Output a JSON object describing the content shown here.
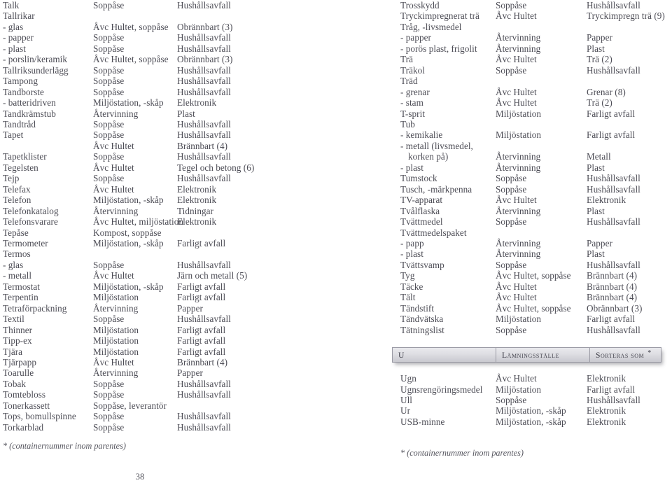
{
  "document": {
    "page_number": "38",
    "footnote": "* (containernummer inom parentes)"
  },
  "section_header": {
    "letter": "U",
    "place_column": "Lämningsställe",
    "sort_column": "Sorteras som",
    "asterisk": "*"
  },
  "left_column": {
    "rows": [
      {
        "item": "Talk",
        "indent": false,
        "place": "Soppåse",
        "sort": "Hushållsavfall"
      },
      {
        "item": "Tallrikar",
        "indent": false,
        "place": "",
        "sort": ""
      },
      {
        "item": "- glas",
        "indent": false,
        "place": "Åvc Hultet, soppåse",
        "sort": "Obrännbart (3)"
      },
      {
        "item": "- papper",
        "indent": false,
        "place": "Soppåse",
        "sort": "Hushållsavfall"
      },
      {
        "item": "- plast",
        "indent": false,
        "place": "Soppåse",
        "sort": "Hushållsavfall"
      },
      {
        "item": "- porslin/keramik",
        "indent": false,
        "place": "Åvc Hultet, soppåse",
        "sort": "Obrännbart (3)"
      },
      {
        "item": "Tallriksunderlägg",
        "indent": false,
        "place": "Soppåse",
        "sort": "Hushållsavfall"
      },
      {
        "item": "Tampong",
        "indent": false,
        "place": "Soppåse",
        "sort": "Hushållsavfall"
      },
      {
        "item": "Tandborste",
        "indent": false,
        "place": "Soppåse",
        "sort": "Hushållsavfall"
      },
      {
        "item": "- batteridriven",
        "indent": false,
        "place": "Miljöstation, -skåp",
        "sort": "Elektronik"
      },
      {
        "item": "Tandkrämstub",
        "indent": false,
        "place": "Återvinning",
        "sort": "Plast"
      },
      {
        "item": "Tandtråd",
        "indent": false,
        "place": "Soppåse",
        "sort": "Hushållsavfall"
      },
      {
        "item": "Tapet",
        "indent": false,
        "place": "Soppåse",
        "sort": "Hushållsavfall"
      },
      {
        "item": "",
        "indent": false,
        "place": "Åvc Hultet",
        "sort": "Brännbart (4)"
      },
      {
        "item": "Tapetklister",
        "indent": false,
        "place": "Soppåse",
        "sort": "Hushållsavfall"
      },
      {
        "item": "Tegelsten",
        "indent": false,
        "place": "Åvc Hultet",
        "sort": "Tegel och betong (6)"
      },
      {
        "item": "Tejp",
        "indent": false,
        "place": "Soppåse",
        "sort": "Hushållsavfall"
      },
      {
        "item": "Telefax",
        "indent": false,
        "place": "Åvc Hultet",
        "sort": "Elektronik"
      },
      {
        "item": "Telefon",
        "indent": false,
        "place": "Miljöstation, -skåp",
        "sort": "Elektronik"
      },
      {
        "item": "Telefonkatalog",
        "indent": false,
        "place": "Återvinning",
        "sort": "Tidningar"
      },
      {
        "item": "Telefonsvarare",
        "indent": false,
        "place": "Åvc Hultet, miljöstation",
        "sort": "Elektronik"
      },
      {
        "item": "Tepåse",
        "indent": false,
        "place": "Kompost, soppåse",
        "sort": ""
      },
      {
        "item": "Termometer",
        "indent": false,
        "place": "Miljöstation, -skåp",
        "sort": "Farligt avfall"
      },
      {
        "item": "Termos",
        "indent": false,
        "place": "",
        "sort": ""
      },
      {
        "item": "- glas",
        "indent": false,
        "place": "Soppåse",
        "sort": "Hushållsavfall"
      },
      {
        "item": "- metall",
        "indent": false,
        "place": "Åvc Hultet",
        "sort": "Järn och metall (5)"
      },
      {
        "item": "Termostat",
        "indent": false,
        "place": "Miljöstation, -skåp",
        "sort": "Farligt avfall"
      },
      {
        "item": "Terpentin",
        "indent": false,
        "place": "Miljöstation",
        "sort": "Farligt avfall"
      },
      {
        "item": "Tetraförpackning",
        "indent": false,
        "place": "Återvinning",
        "sort": "Papper"
      },
      {
        "item": "Textil",
        "indent": false,
        "place": "Soppåse",
        "sort": "Hushållsavfall"
      },
      {
        "item": "Thinner",
        "indent": false,
        "place": "Miljöstation",
        "sort": "Farligt avfall"
      },
      {
        "item": "Tipp-ex",
        "indent": false,
        "place": "Miljöstation",
        "sort": "Farligt avfall"
      },
      {
        "item": "Tjära",
        "indent": false,
        "place": "Miljöstation",
        "sort": "Farligt avfall"
      },
      {
        "item": "Tjärpapp",
        "indent": false,
        "place": "Åvc Hultet",
        "sort": "Brännbart (4)"
      },
      {
        "item": "Toarulle",
        "indent": false,
        "place": "Återvinning",
        "sort": "Papper"
      },
      {
        "item": "Tobak",
        "indent": false,
        "place": "Soppåse",
        "sort": "Hushållsavfall"
      },
      {
        "item": "Tomtebloss",
        "indent": false,
        "place": "Soppåse",
        "sort": "Hushållsavfall"
      },
      {
        "item": "Tonerkassett",
        "indent": false,
        "place": "Soppåse, leverantör",
        "sort": ""
      },
      {
        "item": "Tops, bomullspinne",
        "indent": false,
        "place": "Soppåse",
        "sort": "Hushållsavfall"
      },
      {
        "item": "Torkarblad",
        "indent": false,
        "place": "Soppåse",
        "sort": "Hushållsavfall"
      }
    ]
  },
  "right_column": {
    "rows_before_header": [
      {
        "item": "Trosskydd",
        "indent": false,
        "place": "Soppåse",
        "sort": "Hushållsavfall"
      },
      {
        "item": "Tryckimpregnerat trä",
        "indent": false,
        "place": "Åvc Hultet",
        "sort": "Tryckimpregn trä (9)"
      },
      {
        "item": "Tråg, -livsmedel",
        "indent": false,
        "place": "",
        "sort": ""
      },
      {
        "item": "- papper",
        "indent": false,
        "place": "Återvinning",
        "sort": "Papper"
      },
      {
        "item": "- porös plast, frigolit",
        "indent": false,
        "place": "Återvinning",
        "sort": "Plast"
      },
      {
        "item": "Trä",
        "indent": false,
        "place": "Åvc Hultet",
        "sort": "Trä (2)"
      },
      {
        "item": "Träkol",
        "indent": false,
        "place": "Soppåse",
        "sort": "Hushållsavfall"
      },
      {
        "item": "Träd",
        "indent": false,
        "place": "",
        "sort": ""
      },
      {
        "item": "- grenar",
        "indent": false,
        "place": "Åvc Hultet",
        "sort": "Grenar (8)"
      },
      {
        "item": "- stam",
        "indent": false,
        "place": "Åvc Hultet",
        "sort": "Trä (2)"
      },
      {
        "item": "T-sprit",
        "indent": false,
        "place": "Miljöstation",
        "sort": "Farligt avfall"
      },
      {
        "item": "Tub",
        "indent": false,
        "place": "",
        "sort": ""
      },
      {
        "item": "- kemikalie",
        "indent": false,
        "place": "Miljöstation",
        "sort": "Farligt avfall"
      },
      {
        "item": "- metall (livsmedel,",
        "indent": false,
        "place": "",
        "sort": ""
      },
      {
        "item": "korken på)",
        "indent": true,
        "place": "Återvinning",
        "sort": "Metall"
      },
      {
        "item": "- plast",
        "indent": false,
        "place": "Återvinning",
        "sort": "Plast"
      },
      {
        "item": "Tumstock",
        "indent": false,
        "place": "Soppåse",
        "sort": "Hushållsavfall"
      },
      {
        "item": "Tusch, -märkpenna",
        "indent": false,
        "place": "Soppåse",
        "sort": "Hushållsavfall"
      },
      {
        "item": "TV-apparat",
        "indent": false,
        "place": "Åvc Hultet",
        "sort": "Elektronik"
      },
      {
        "item": "Tvålflaska",
        "indent": false,
        "place": "Återvinning",
        "sort": "Plast"
      },
      {
        "item": "Tvättmedel",
        "indent": false,
        "place": "Soppåse",
        "sort": "Hushållsavfall"
      },
      {
        "item": "Tvättmedelspaket",
        "indent": false,
        "place": "",
        "sort": ""
      },
      {
        "item": "- papp",
        "indent": false,
        "place": "Återvinning",
        "sort": "Papper"
      },
      {
        "item": "- plast",
        "indent": false,
        "place": "Återvinning",
        "sort": "Plast"
      },
      {
        "item": "Tvättsvamp",
        "indent": false,
        "place": "Soppåse",
        "sort": "Hushållsavfall"
      },
      {
        "item": "Tyg",
        "indent": false,
        "place": "Åvc Hultet, soppåse",
        "sort": "Brännbart (4)"
      },
      {
        "item": "Täcke",
        "indent": false,
        "place": "Åvc Hultet",
        "sort": "Brännbart (4)"
      },
      {
        "item": "Tält",
        "indent": false,
        "place": "Åvc Hultet",
        "sort": "Brännbart (4)"
      },
      {
        "item": "Tändstift",
        "indent": false,
        "place": "Åvc Hultet, soppåse",
        "sort": "Obrännbart (3)"
      },
      {
        "item": "Tändvätska",
        "indent": false,
        "place": "Miljöstation",
        "sort": "Farligt avfall"
      },
      {
        "item": "Tätningslist",
        "indent": false,
        "place": "Soppåse",
        "sort": "Hushållsavfall"
      }
    ],
    "rows_after_header": [
      {
        "item": "Ugn",
        "indent": false,
        "place": "Åvc Hultet",
        "sort": "Elektronik"
      },
      {
        "item": "Ugnsrengöringsmedel",
        "indent": false,
        "place": "Miljöstation",
        "sort": "Farligt avfall"
      },
      {
        "item": "Ull",
        "indent": false,
        "place": "Soppåse",
        "sort": "Hushållsavfall"
      },
      {
        "item": "Ur",
        "indent": false,
        "place": "Miljöstation, -skåp",
        "sort": "Elektronik"
      },
      {
        "item": "USB-minne",
        "indent": false,
        "place": "Miljöstation, -skåp",
        "sort": "Elektronik"
      }
    ]
  }
}
